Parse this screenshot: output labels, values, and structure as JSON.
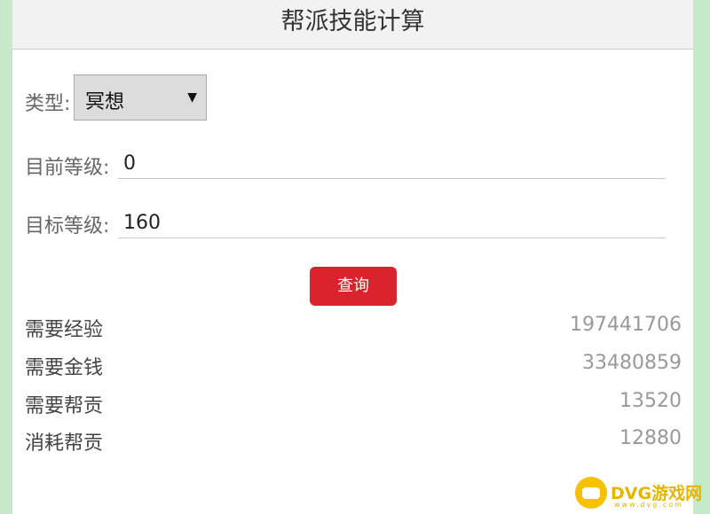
{
  "header": {
    "title": "帮派技能计算"
  },
  "form": {
    "type_label": "类型:",
    "type_value": "冥想",
    "current_level_label": "目前等级:",
    "current_level_value": "0",
    "target_level_label": "目标等级:",
    "target_level_value": "160",
    "query_label": "查询"
  },
  "results": [
    {
      "label": "需要经验",
      "value": "197441706"
    },
    {
      "label": "需要金钱",
      "value": "33480859"
    },
    {
      "label": "需要帮贡",
      "value": "13520"
    },
    {
      "label": "消耗帮贡",
      "value": "12880"
    }
  ],
  "watermark": {
    "text": "DVG游戏网",
    "sub": "www.dvg.com"
  },
  "colors": {
    "background": "#c6e9c8",
    "header_bg": "#f2f2f2",
    "button": "#d9232d",
    "watermark": "#e6b500"
  }
}
